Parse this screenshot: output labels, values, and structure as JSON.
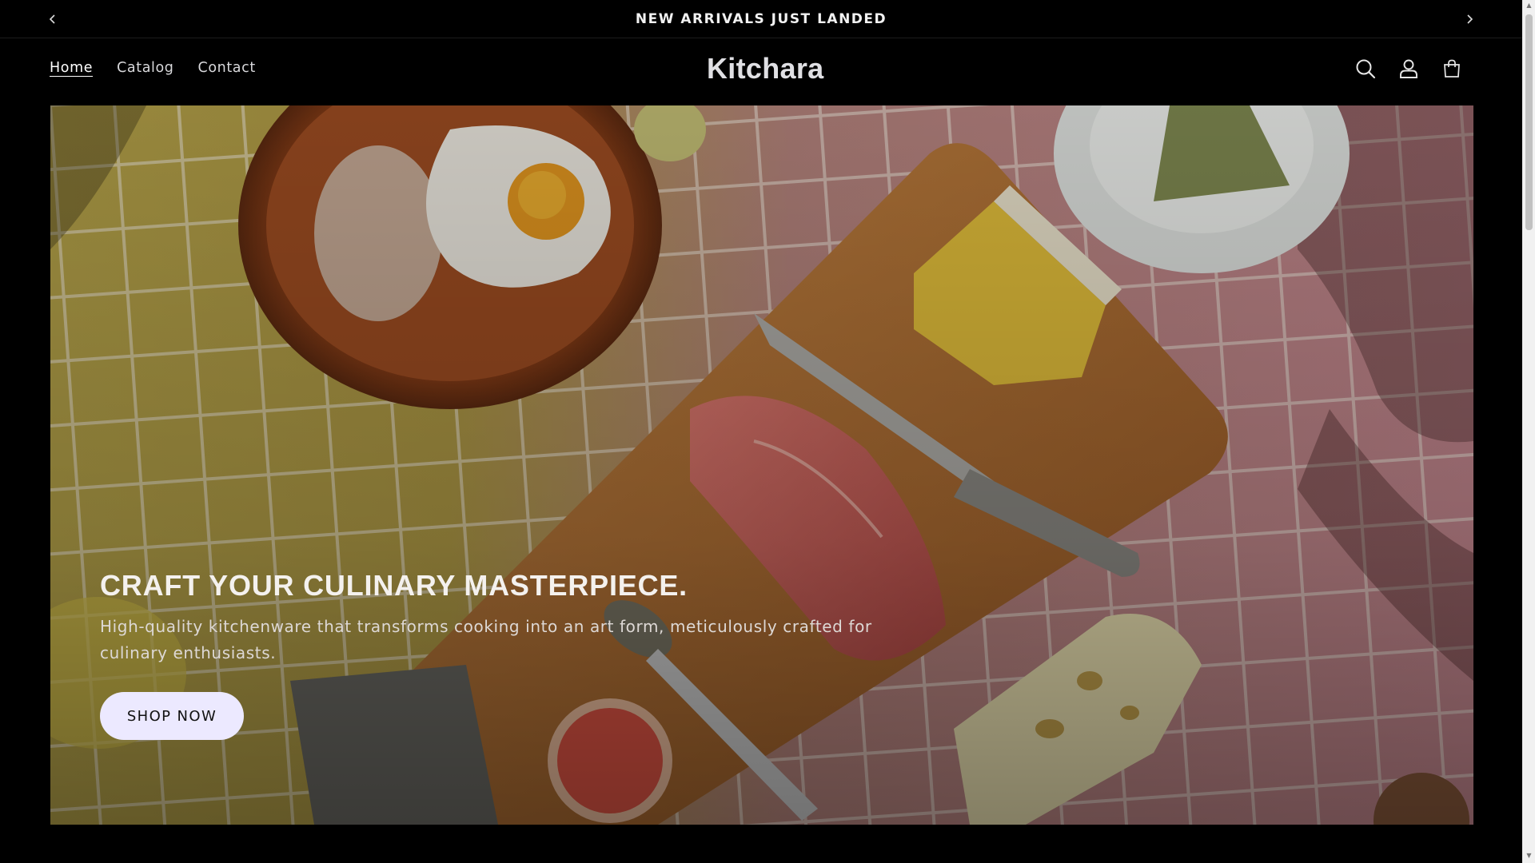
{
  "announcement": {
    "text": "NEW ARRIVALS JUST LANDED",
    "prev_icon": "chevron-left-icon",
    "next_icon": "chevron-right-icon"
  },
  "header": {
    "nav": [
      {
        "label": "Home",
        "active": true
      },
      {
        "label": "Catalog",
        "active": false
      },
      {
        "label": "Contact",
        "active": false
      }
    ],
    "logo": "Kitchara",
    "icons": [
      "search-icon",
      "account-icon",
      "cart-icon"
    ]
  },
  "hero": {
    "title": "CRAFT YOUR CULINARY MASTERPIECE.",
    "subtitle": "High-quality kitchenware that transforms cooking into an art form, meticulously crafted for culinary enthusiasts.",
    "cta_label": "SHOP NOW",
    "image": "food-flatlay-photo"
  },
  "colors": {
    "background": "#000000",
    "cta_background": "#ece9ff",
    "text": "#f4f1ee"
  }
}
